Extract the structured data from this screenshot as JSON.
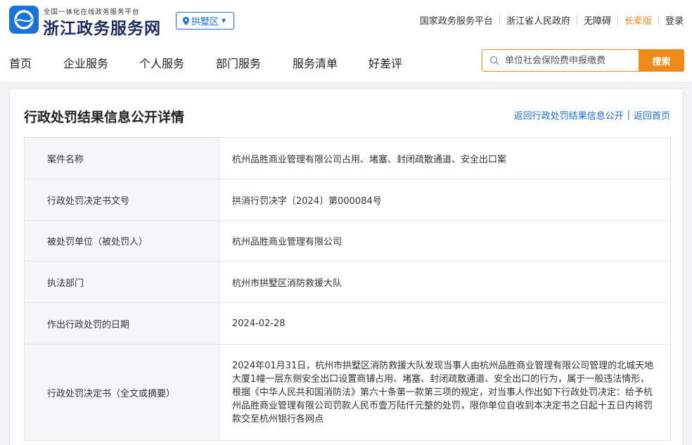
{
  "header": {
    "subtitle": "全国一体化在线政务服务平台",
    "title": "浙江政务服务网",
    "region": "拱墅区",
    "links": [
      "国家政务服务平台",
      "浙江省人民政府",
      "无障碍",
      "长辈版",
      "登录"
    ],
    "colors": {
      "brand_blue": "#1a6fd8",
      "accent_orange": "#f08a1c"
    }
  },
  "nav": {
    "items": [
      "首页",
      "企业服务",
      "个人服务",
      "部门服务",
      "服务清单",
      "好差评"
    ],
    "search_placeholder": "单位社会保险费申报缴费",
    "search_button": "搜索"
  },
  "main": {
    "title": "行政处罚结果信息公开详情",
    "back_list": "返回行政处罚结果信息公开",
    "back_home": "返回首页",
    "rows": [
      {
        "label": "案件名称",
        "value": "杭州品胜商业管理有限公司占用、堵塞、封闭疏散通道、安全出口案"
      },
      {
        "label": "行政处罚决定书文号",
        "value": "拱消行罚决字〔2024〕第000084号"
      },
      {
        "label": "被处罚单位（被处罚人）",
        "value": "杭州品胜商业管理有限公司"
      },
      {
        "label": "执法部门",
        "value": "杭州市拱墅区消防救援大队"
      },
      {
        "label": "作出行政处罚的日期",
        "value": "2024-02-28"
      },
      {
        "label": "行政处罚决定书（全文或摘要）",
        "value": "2024年01月31日，杭州市拱墅区消防救援大队发现当事人由杭州品胜商业管理有限公司管理的北城天地大厦1幢一层东侧安全出口设置商铺占用、堵塞、封闭疏散通道、安全出口的行为，属于一般违法情形，根据《中华人民共和国消防法》第六十条第一款第三项的规定，对当事人作出如下行政处罚决定：给予杭州品胜商业管理有限公司罚款人民币壹万陆仟元整的处罚，限你单位自收到本决定书之日起十五日内将罚款交至杭州银行各网点"
      }
    ]
  }
}
